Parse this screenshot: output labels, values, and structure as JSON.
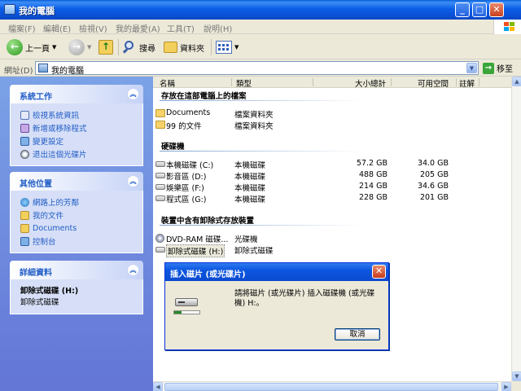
{
  "window": {
    "title": "我的電腦",
    "buttons": {
      "minimize": "_",
      "maximize": "□",
      "close": "✕"
    }
  },
  "menubar": {
    "items": [
      "檔案(F)",
      "編輯(E)",
      "檢視(V)",
      "我的最愛(A)",
      "工具(T)",
      "說明(H)"
    ]
  },
  "toolbar": {
    "back_label": "上一頁",
    "search_label": "搜尋",
    "folders_label": "資料夾"
  },
  "address": {
    "label": "網址(D)",
    "value": "我的電腦",
    "go_label": "移至"
  },
  "taskpane": {
    "system_tasks": {
      "title": "系統工作",
      "items": [
        "檢視系統資訊",
        "新增或移除程式",
        "變更設定",
        "退出這個光碟片"
      ]
    },
    "other_places": {
      "title": "其他位置",
      "items": [
        "網路上的芳鄰",
        "我的文件",
        "Documents",
        "控制台"
      ]
    },
    "details": {
      "title": "詳細資料",
      "name": "卸除式磁碟 (H:)",
      "type": "卸除式磁碟"
    }
  },
  "columns": {
    "name": "名稱",
    "type": "類型",
    "total": "大小總計",
    "free": "可用空間",
    "comment": "註解"
  },
  "groups": {
    "files": "存放在這部電腦上的檔案",
    "hard_disks": "硬碟機",
    "removable": "裝置中含有卸除式存放裝置"
  },
  "files": [
    {
      "name": "Documents",
      "type": "檔案資料夾"
    },
    {
      "name": "99 的文件",
      "type": "檔案資料夾"
    }
  ],
  "drives": [
    {
      "name": "本機磁碟 (C:)",
      "type": "本機磁碟",
      "total": "57.2 GB",
      "free": "34.0 GB"
    },
    {
      "name": "影音區 (D:)",
      "type": "本機磁碟",
      "total": "488 GB",
      "free": "205 GB"
    },
    {
      "name": "娛樂區 (F:)",
      "type": "本機磁碟",
      "total": "214 GB",
      "free": "34.6 GB"
    },
    {
      "name": "程式區 (G:)",
      "type": "本機磁碟",
      "total": "228 GB",
      "free": "201 GB"
    }
  ],
  "removable": [
    {
      "name": "DVD-RAM 磁碟...",
      "type": "光碟機"
    },
    {
      "name": "卸除式磁碟 (H:)",
      "type": "卸除式磁碟"
    }
  ],
  "dialog": {
    "title": "插入磁片 (或光碟片)",
    "message": "請將磁片 (或光碟片) 插入磁碟機 (或光碟機) H:。",
    "cancel_label": "取消",
    "close_label": "✕"
  }
}
